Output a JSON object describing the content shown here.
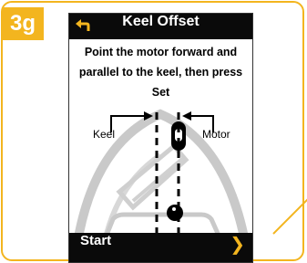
{
  "step": {
    "label": "3g"
  },
  "header": {
    "back_icon": "back-arrow-icon",
    "title": "Keel Offset"
  },
  "instructions": {
    "line1": "Point the motor forward and",
    "line2": "parallel to the keel, then press",
    "line3": "Set"
  },
  "diagram": {
    "keel_label": "Keel",
    "motor_label": "Motor"
  },
  "footer": {
    "start_label": "Start",
    "chevron_icon": "chevron-right-icon"
  },
  "colors": {
    "accent": "#f3b51f",
    "bar": "#0a0a0a",
    "boat_gray": "#c9c9c9"
  }
}
